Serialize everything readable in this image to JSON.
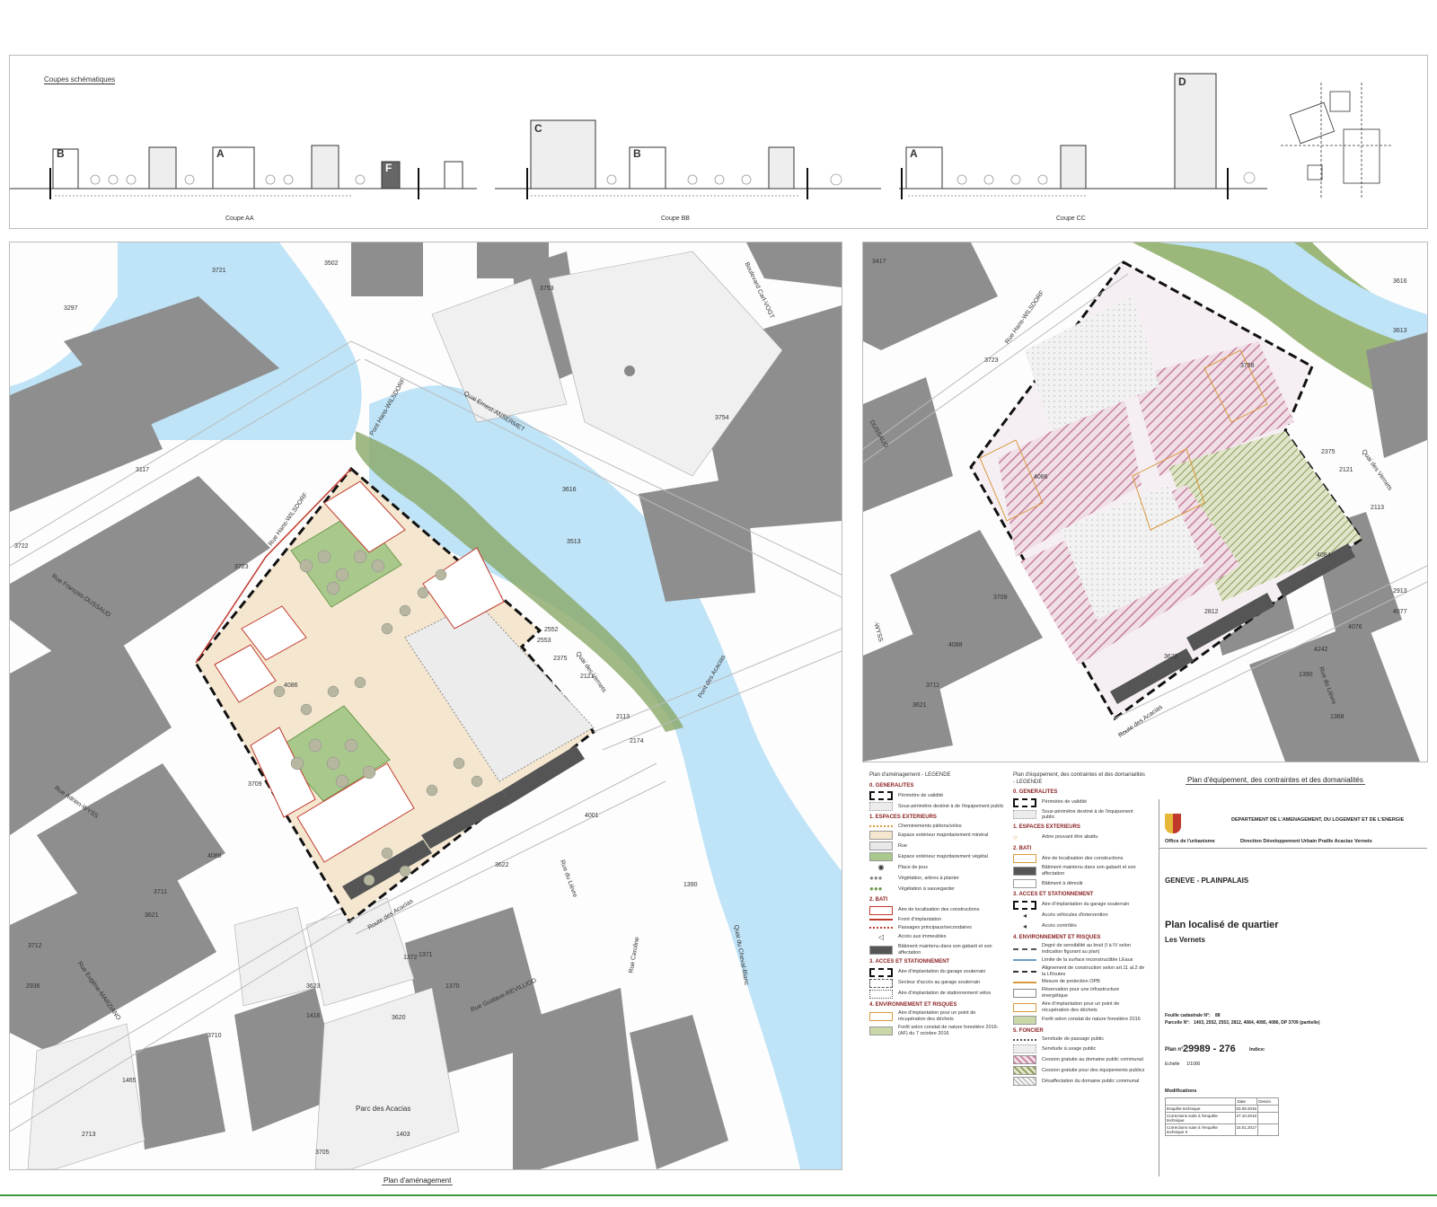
{
  "sections": {
    "sections_title": "Coupes schématiques",
    "coupe_aa": "Coupe AA",
    "coupe_bb": "Coupe BB",
    "coupe_cc": "Coupe CC",
    "letters": [
      "A",
      "B",
      "C",
      "D",
      "F"
    ]
  },
  "plan_left": {
    "caption": "Plan d'aménagement",
    "streets": {
      "quai_ansermet": "Quai Ernest-ANSERMET",
      "pont_wilsdorf": "Pont Hans-WILSDORF",
      "rue_wilsdorf": "Rue Hans-WILSDORF",
      "rue_dussaud": "Rue François-DUSSAUD",
      "rue_wyss": "Rue Adrien-WYSS",
      "route_acacias": "Route des Acacias",
      "quai_vernets": "Quai des Vernets",
      "pont_acacias": "Pont des Acacias",
      "bd_vogt": "Boulevard Carl-VOGT",
      "rue_marziano": "Rue Eugène-MARZIANO",
      "rue_revilliod": "Rue Gustave-REVILLIOD",
      "rue_lievre": "Rue du Lièvre",
      "rue_caroline": "Rue Caroline",
      "quai_chevre": "Quai du Cheval-Blanc",
      "parc_acacias": "Parc des Acacias"
    },
    "parcels": [
      "3721",
      "3297",
      "3502",
      "3753",
      "3117",
      "3722",
      "3723",
      "3513",
      "3616",
      "3754",
      "4086",
      "3709",
      "4088",
      "3711",
      "3621",
      "3622",
      "3623",
      "2174",
      "2552",
      "2553",
      "2375",
      "2121",
      "2113",
      "4001",
      "1370",
      "1371",
      "1372",
      "1390",
      "3620",
      "3710",
      "3712",
      "2936",
      "3705",
      "2713",
      "1403",
      "1416",
      "1465"
    ]
  },
  "plan_right": {
    "caption": "Plan d'équipement, des contraintes et des domanialités",
    "streets": {
      "rue_wilsdorf": "Rue Hans-WILSDORF",
      "quai_vernets": "Quai des Vernets",
      "route_acacias": "Route des Acacias",
      "rue_lievre": "Rue du Lièvre",
      "rue_dussaud": "DUSSAUD",
      "rue_wyss": "-WYSS"
    },
    "parcels": [
      "3417",
      "3723",
      "3758",
      "3613",
      "3616",
      "2375",
      "2121",
      "2113",
      "4086",
      "4084",
      "2812",
      "3709",
      "3711",
      "3621",
      "4088",
      "3622",
      "4076",
      "4242",
      "1390",
      "1368",
      "2913",
      "4077"
    ]
  },
  "legend_left": {
    "title": "Plan d'aménagement - LEGENDE",
    "g0": "0. GENERALITES",
    "i0a": "Périmètre de validité",
    "i0b": "Sous-périmètre destiné à de l'équipement public",
    "g1": "1. ESPACES EXTERIEURS",
    "i1a": "Cheminements piétons/vélos",
    "i1b": "Espace extérieur majoritairement minéral",
    "i1c": "Rue",
    "i1d": "Espace extérieur majoritairement végétal",
    "i1e": "Place de jeux",
    "i1f": "Végétation, arbres à planter",
    "i1g": "Végétation à sauvegarder",
    "g2": "2. BATI",
    "i2a": "Aire de localisation des constructions",
    "i2b": "Front d'implantation",
    "i2c": "Passages principaux/secondaires",
    "i2d": "Accès aux immeubles",
    "i2e": "Bâtiment maintenu dans son gabarit et son affectation",
    "g3": "3. ACCES ET STATIONNEMENT",
    "i3a": "Aire d'implantation du garage souterrain",
    "i3b": "Secteur d'accès au garage souterrain",
    "i3c": "Aire d'implantation de stationnement vélos",
    "g4": "4. ENVIRONNEMENT ET RISQUES",
    "i4a": "Aire d'implantation pour un point de récupération des déchets",
    "i4b": "Forêt selon constat de nature forestière 2016-(AF) du 7 octobre 2016"
  },
  "legend_right": {
    "title": "Plan d'équipement, des contraintes et des domanialités - LEGENDE",
    "g0": "0. GENERALITES",
    "i0a": "Périmètre de validité",
    "i0b": "Sous-périmètre destiné à de l'équipement public",
    "g1": "1. ESPACES EXTERIEURS",
    "i1a": "Arbre pouvant être abattu",
    "g2": "2. BATI",
    "i2a": "Aire de localisation des constructions",
    "i2b": "Bâtiment maintenu dans son gabarit et son affectation",
    "i2c": "Bâtiment à démolir",
    "g3": "3. ACCES ET STATIONNEMENT",
    "i3a": "Aire d'implantation du garage souterrain",
    "i3b": "Accès véhicules d'intervention",
    "i3c": "Accès contrôlés",
    "g4": "4. ENVIRONNEMENT ET RISQUES",
    "i4a": "Degré de sensibilité au bruit (I à IV selon indication figurant au plan)",
    "i4b": "Limite de la surface inconstructible LEaux",
    "i4c": "Alignement de construction selon art.11 al.2 de la LRoutes",
    "i4d": "Mesure de protection OPB",
    "i4e": "Réservation pour une infrastructure énergétique",
    "i4f": "Aire d'implantation pour un point de récupération des déchets",
    "i4g": "Forêt selon constat de nature forestière 2016",
    "g5": "5. FONCIER",
    "i5a": "Servitude de passage public",
    "i5b": "Servitude à usage public",
    "i5c": "Cession gratuite au domaine public communal",
    "i5d": "Cession gratuite pour des équipements publics",
    "i5e": "Désaffectation du domaine public communal"
  },
  "title_block": {
    "dept": "DEPARTEMENT DE L'AMENAGEMENT, DU LOGEMENT ET DE L'ENERGIE",
    "office": "Office de l'urbanisme",
    "direction": "Direction Développement Urbain Praille Acacias Vernets",
    "commune": "GENEVE - PLAINPALAIS",
    "plan_title": "Plan localisé de quartier",
    "plan_subtitle": "Les Vernets",
    "feuille_label": "Feuille cadastrale N°:",
    "feuille_value": "88",
    "parcelles_label": "Parcelle N°:",
    "parcelles_value": "1403, 2552, 2553, 2812, 4084, 4085, 4086, DP 3709 (partielle)",
    "plan_no_label": "Plan n°",
    "plan_no": "29989 - 276",
    "indice_label": "Indice:",
    "echelle_label": "Echelle",
    "echelle": "1/1000",
    "modif_label": "Modifications",
    "date_col": "Date",
    "dessin_col": "Dessin",
    "mods": [
      [
        "Enquête technique",
        "03.09.2016"
      ],
      [
        "Corrections suite à l'enquête technique",
        "27.10.2016"
      ],
      [
        "Corrections suite à l'enquête technique II",
        "15.01.2017"
      ]
    ]
  },
  "colors": {
    "water": "#bfe3f7",
    "building": "#8e8e8e",
    "perimeter": "#111111",
    "green": "#a9c98c",
    "mineral": "#f4e6cf",
    "red": "#c0392b",
    "forest": "#8aa866"
  }
}
